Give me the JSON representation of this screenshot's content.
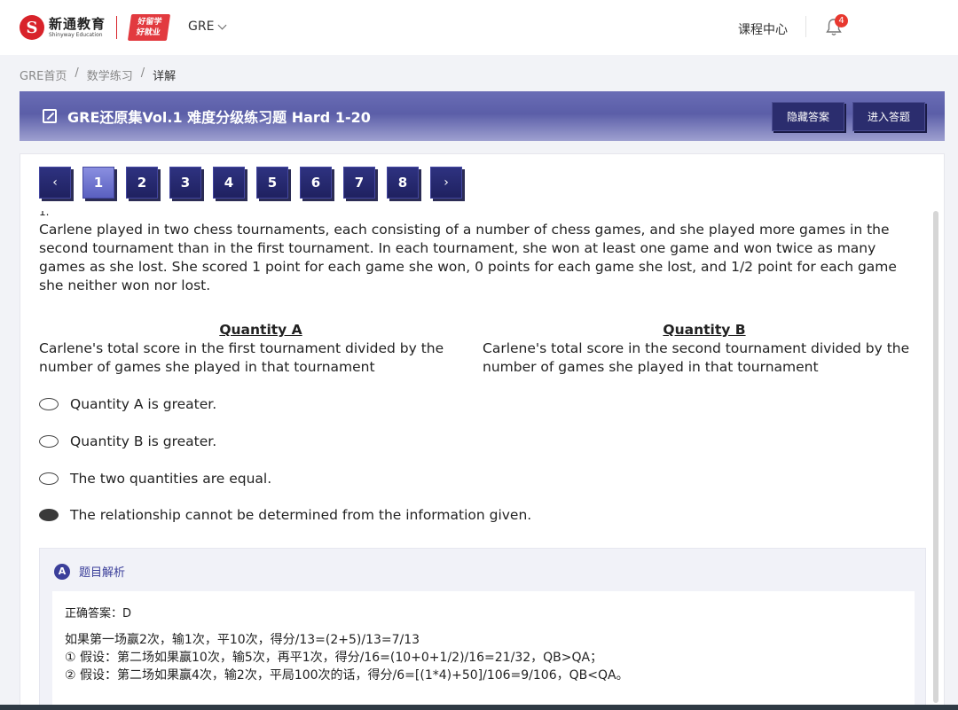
{
  "header": {
    "logo_mark": "S",
    "logo_cn": "新通教育",
    "logo_en": "Shinyway Education",
    "slogan_line1": "好留学",
    "slogan_line2": "好就业",
    "exam_menu": "GRE",
    "course_center": "课程中心",
    "notification_count": "4"
  },
  "breadcrumb": {
    "items": [
      "GRE首页",
      "数学练习",
      "详解"
    ],
    "separator": "/"
  },
  "titlebar": {
    "title": "GRE还原集Vol.1 难度分级练习题 Hard 1-20",
    "hide_answer_label": "隐藏答案",
    "enter_answer_label": "进入答题"
  },
  "pager": {
    "prev": "‹",
    "next": "›",
    "pages": [
      "1",
      "2",
      "3",
      "4",
      "5",
      "6",
      "7",
      "8"
    ],
    "active_page": "1"
  },
  "question": {
    "number": "1.",
    "text": "Carlene played in two chess tournaments, each consisting of a number of chess games, and she played more games in the second tournament than in the first tournament. In each tournament, she won at least one game and won twice as many games as she lost. She scored 1 point for each game she won, 0 points for each game she lost, and 1/2 point for each game she neither won nor lost.",
    "quantity_a": {
      "heading": "Quantity A",
      "text": "Carlene's total score in the first tournament divided by the number of games she played in that tournament"
    },
    "quantity_b": {
      "heading": "Quantity B",
      "text": "Carlene's total score in the second tournament divided by the number of games she played in that tournament"
    },
    "options": [
      {
        "label": "Quantity A is greater.",
        "selected": false
      },
      {
        "label": "Quantity B is greater.",
        "selected": false
      },
      {
        "label": "The two quantities are equal.",
        "selected": false
      },
      {
        "label": "The relationship cannot be determined from the information given.",
        "selected": true
      }
    ]
  },
  "analysis": {
    "badge": "A",
    "title": "题目解析",
    "correct_answer": "正确答案：D",
    "lines": [
      "如果第一场赢2次，输1次，平10次，得分/13=(2+5)/13=7/13",
      "① 假设：第二场如果赢10次，输5次，再平1次，得分/16=(10+0+1/2)/16=21/32，QB>QA；",
      "② 假设：第二场如果赢4次，输2次，平局100次的话，得分/6=[(1*4)+50]/106=9/106，QB<QA。"
    ]
  }
}
